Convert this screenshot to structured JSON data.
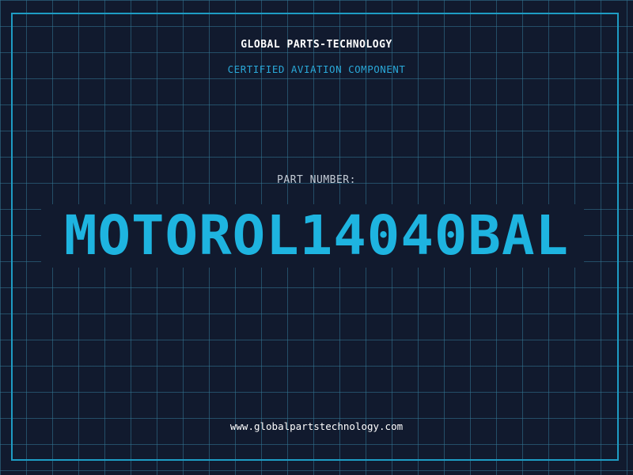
{
  "header": {
    "company": "GLOBAL PARTS-TECHNOLOGY",
    "subtitle": "CERTIFIED AVIATION COMPONENT"
  },
  "part": {
    "label": "PART NUMBER:",
    "number": "MOTOROL14040BAL"
  },
  "footer": {
    "url": "www.globalpartstechnology.com"
  },
  "colors": {
    "background": "#111a2e",
    "grid": "#347896",
    "frame": "#1e9cc4",
    "accent": "#1eb4e0",
    "title": "#ffffff",
    "label": "#c4ccd6"
  }
}
